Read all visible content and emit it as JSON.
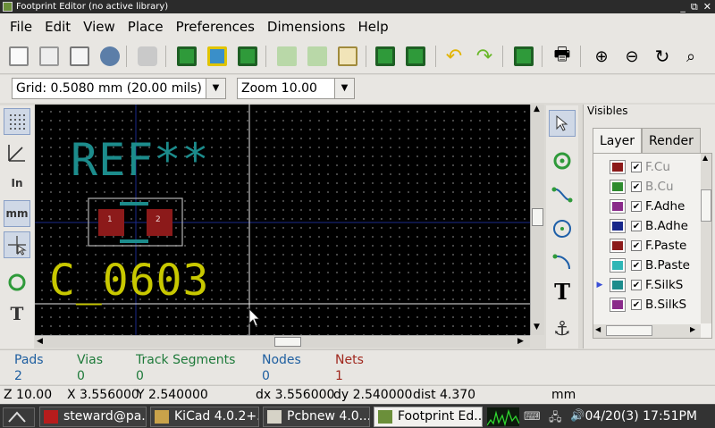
{
  "window": {
    "title": "Footprint Editor (no active library)",
    "controls": [
      "_",
      "⧉",
      "✕"
    ]
  },
  "menu": [
    "File",
    "Edit",
    "View",
    "Place",
    "Preferences",
    "Dimensions",
    "Help"
  ],
  "toolbar": {
    "icons": [
      "library-browse-icon",
      "new-library-icon",
      "open-library-icon",
      "load-footprint-icon",
      "delete-part-icon",
      "new-footprint-icon",
      "footprint-wizard-icon",
      "save-footprint-icon",
      "import-footprint-icon",
      "export-footprint-icon",
      "edit-properties-icon",
      "load-from-board-icon",
      "insert-into-board-icon",
      "undo-icon",
      "redo-icon",
      "pad-settings-icon",
      "print-icon",
      "zoom-in-icon",
      "zoom-out-icon",
      "redraw-icon",
      "zoom-fit-icon"
    ]
  },
  "options": {
    "grid": "Grid: 0.5080 mm (20.00 mils)",
    "zoom": "Zoom 10.00"
  },
  "left_toolbar": [
    "grid-toggle-icon",
    "polar-coords-icon",
    "units-inches-icon",
    "units-mm-icon",
    "full-cursor-icon",
    "pad-sketch-icon",
    "text-sketch-icon"
  ],
  "left_labels": {
    "inches": "In",
    "mm": "mm"
  },
  "right_toolbar": [
    "select-arrow-icon",
    "add-pad-icon",
    "add-line-icon",
    "add-circle-icon",
    "add-arc-icon",
    "add-text-icon",
    "anchor-icon"
  ],
  "canvas": {
    "ref_text": "REF**",
    "value_text": "C_0603",
    "pad1": "1",
    "pad2": "2"
  },
  "visibles": {
    "title": "Visibles",
    "tabs": [
      "Layer",
      "Render"
    ],
    "layers": [
      {
        "name": "F.Cu",
        "color": "#8c1a1a",
        "dim": true
      },
      {
        "name": "B.Cu",
        "color": "#2e8b2e",
        "dim": true
      },
      {
        "name": "F.Adhe",
        "color": "#8a2a8a",
        "dim": false
      },
      {
        "name": "B.Adhe",
        "color": "#16268a",
        "dim": false
      },
      {
        "name": "F.Paste",
        "color": "#8c1a1a",
        "dim": false
      },
      {
        "name": "B.Paste",
        "color": "#2fb6b6",
        "dim": false
      },
      {
        "name": "F.SilkS",
        "color": "#1c8c8c",
        "dim": false,
        "current": true
      },
      {
        "name": "B.SilkS",
        "color": "#8a2a8a",
        "dim": false
      }
    ]
  },
  "messages": {
    "pads": {
      "label": "Pads",
      "value": "2"
    },
    "vias": {
      "label": "Vias",
      "value": "0"
    },
    "tracks": {
      "label": "Track Segments",
      "value": "0"
    },
    "nodes": {
      "label": "Nodes",
      "value": "0"
    },
    "nets": {
      "label": "Nets",
      "value": "1"
    }
  },
  "status": {
    "zoom": "Z 10.00",
    "x": "X 3.556000",
    "y": "Y 2.540000",
    "dx": "dx 3.556000",
    "dy": "dy 2.540000",
    "dist": "dist 4.370",
    "units": "mm"
  },
  "taskbar": {
    "tasks": [
      "steward@pa...",
      "KiCad 4.0.2+...",
      "Pcbnew 4.0....",
      "Footprint Ed..."
    ],
    "clock": "04/20(3) 17:51PM"
  }
}
